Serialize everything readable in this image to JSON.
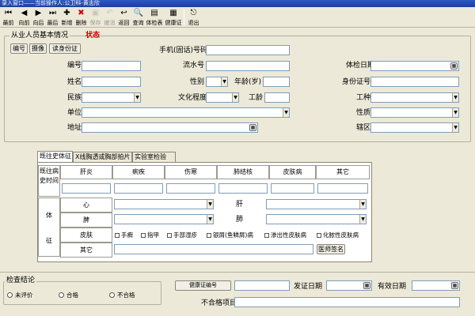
{
  "window": {
    "title": "录入窗口——当前操作人:公卫科-黄志欣"
  },
  "toolbar": {
    "items": [
      {
        "label": "最前",
        "icon": "first-icon"
      },
      {
        "label": "向前",
        "icon": "prev-icon"
      },
      {
        "label": "向后",
        "icon": "next-icon"
      },
      {
        "label": "最后",
        "icon": "last-icon"
      },
      {
        "label": "新增",
        "icon": "add-icon"
      },
      {
        "label": "删除",
        "icon": "delete-icon"
      },
      {
        "label": "保存",
        "icon": "save-icon"
      },
      {
        "label": "撤消",
        "icon": "undo-icon"
      },
      {
        "label": "返回",
        "icon": "return-icon"
      },
      {
        "label": "查询",
        "icon": "query-icon"
      },
      {
        "label": "体检表",
        "icon": "exam-form-icon"
      },
      {
        "label": "健康证",
        "icon": "certificate-icon"
      },
      {
        "label": "退出",
        "icon": "exit-icon"
      }
    ]
  },
  "basic": {
    "group_title": "从业人员基本情况",
    "status_label": "状态",
    "buttons": {
      "number": "编号",
      "capture": "摄像",
      "read_id": "读身份证"
    },
    "labels": {
      "phone": "手机(固话)号码",
      "number": "编号",
      "serial": "流水号",
      "exam_date": "体检日期",
      "name": "姓名",
      "gender": "性别",
      "age": "年龄(岁)",
      "id_card": "身份证号",
      "ethnicity": "民族",
      "education": "文化程度",
      "seniority": "工龄",
      "job_type": "工种",
      "unit": "单位",
      "nature": "性质",
      "address": "地址",
      "district": "辖区"
    }
  },
  "tabs": [
    {
      "label": "既往史体征"
    },
    {
      "label": "X线胸透或胸部拍片"
    },
    {
      "label": "实验室检验"
    }
  ],
  "history": {
    "row_label": "既往病史时间",
    "headers": [
      "肝炎",
      "痢疾",
      "伤寒",
      "肺结核",
      "皮肤病",
      "其它"
    ]
  },
  "signs": {
    "side_top": "体",
    "side_bottom": "征",
    "heart": "心",
    "liver": "肝",
    "spleen": "脾",
    "lung": "肺",
    "skin": "皮肤",
    "other": "其它",
    "skin_options": [
      "手癣",
      "指甲",
      "手部湿疹",
      "银屑(鱼鳞屑)病",
      "渗出性皮肤病",
      "化脓性皮肤病"
    ],
    "doctor_sign": "医师签名"
  },
  "conclusion": {
    "group_title": "检查结论",
    "options": [
      "未评价",
      "合格",
      "不合格"
    ],
    "cert_button": "健康证编号",
    "issue_date": "发证日期",
    "valid_date": "有效日期",
    "fail_items": "不合格项目"
  },
  "colors": {
    "status": "#d00000",
    "titlebar": "#1d3f9e",
    "field_border": "#7f9db9"
  }
}
